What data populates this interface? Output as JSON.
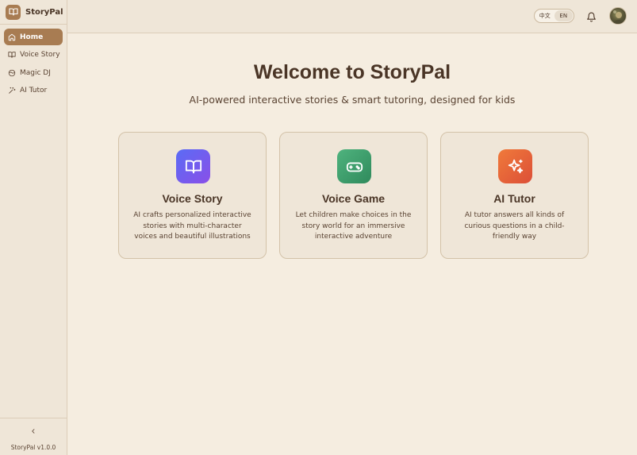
{
  "app": {
    "name": "StoryPal",
    "version": "StoryPal v1.0.0"
  },
  "sidebar": {
    "items": [
      {
        "label": "Home",
        "icon": "home-icon",
        "active": true
      },
      {
        "label": "Voice Story",
        "icon": "book-icon",
        "active": false
      },
      {
        "label": "Magic DJ",
        "icon": "disc-icon",
        "active": false
      },
      {
        "label": "AI Tutor",
        "icon": "sparkle-icon",
        "active": false
      }
    ],
    "collapse_icon": "chevron-left-icon"
  },
  "header": {
    "lang_options": [
      "中文",
      "EN"
    ],
    "lang_selected": "EN",
    "bell_icon": "bell-icon",
    "avatar_icon": "avatar"
  },
  "main": {
    "title": "Welcome to StoryPal",
    "subtitle": "AI-powered interactive stories & smart tutoring, designed for kids",
    "cards": [
      {
        "title": "Voice Story",
        "description": "AI crafts personalized interactive stories with multi-character voices and beautiful illustrations",
        "icon": "book-open-icon",
        "color": "#6a5cf0"
      },
      {
        "title": "Voice Game",
        "description": "Let children make choices in the story world for an immersive interactive adventure",
        "icon": "gamepad-icon",
        "color": "#3f9f6e"
      },
      {
        "title": "AI Tutor",
        "description": "AI tutor answers all kinds of curious questions in a child-friendly way",
        "icon": "sparkles-icon",
        "color": "#e8663a"
      }
    ]
  },
  "colors": {
    "accent": "#a87c52",
    "background": "#f5ede0",
    "sidebar_bg": "#efe6d8",
    "text": "#4a3526"
  }
}
